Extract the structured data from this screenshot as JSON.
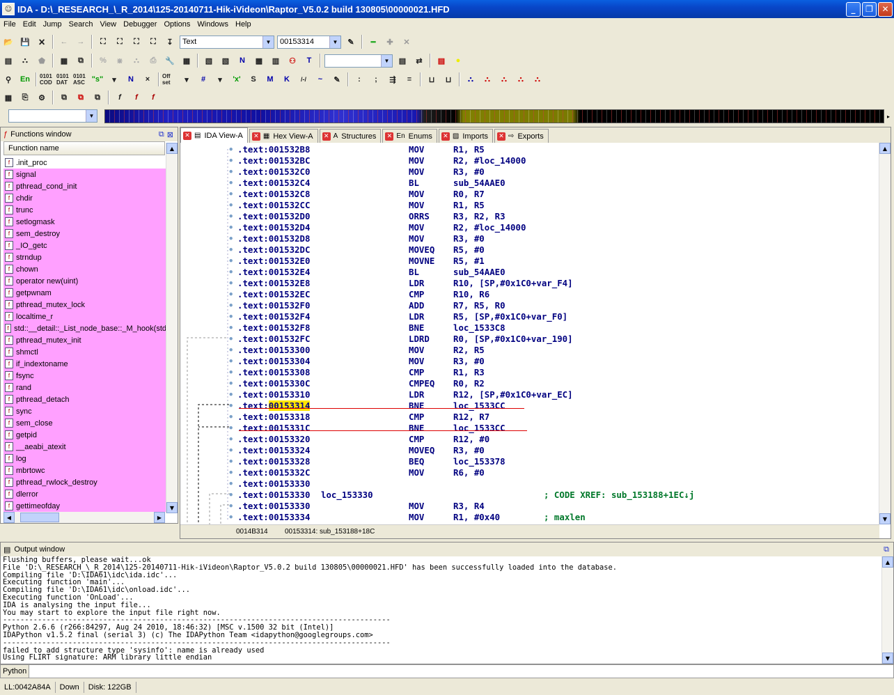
{
  "window": {
    "title": "IDA - D:\\_RESEARCH_\\_R_2014\\125-20140711-Hik-iVideon\\Raptor_V5.0.2 build 130805\\00000021.HFD",
    "minimize": "_",
    "maximize": "❐",
    "close": "✕"
  },
  "menu": [
    "File",
    "Edit",
    "Jump",
    "Search",
    "View",
    "Debugger",
    "Options",
    "Windows",
    "Help"
  ],
  "toolbar": {
    "segment_combo": "Text",
    "address_combo": "00153314",
    "row3": [
      "En",
      "0101 COD",
      "0101 DAT",
      "0101 ASC",
      "\"s\"",
      "N",
      "×",
      "Off set",
      "#",
      "'x'",
      "S",
      "M",
      "K",
      "/-/",
      "~"
    ],
    "row4": [
      "f",
      "f",
      "f"
    ]
  },
  "functions_window": {
    "title": "Functions window",
    "column_header": "Function name",
    "items": [
      ".init_proc",
      "signal",
      "pthread_cond_init",
      "chdir",
      "trunc",
      "setlogmask",
      "sem_destroy",
      "_IO_getc",
      "strndup",
      "chown",
      "operator new(uint)",
      "getpwnam",
      "pthread_mutex_lock",
      "localtime_r",
      "std::__detail::_List_node_base::_M_hook(std",
      "pthread_mutex_init",
      "shmctl",
      "if_indextoname",
      "fsync",
      "rand",
      "pthread_detach",
      "sync",
      "sem_close",
      "getpid",
      "__aeabi_atexit",
      "log",
      "mbrtowc",
      "pthread_rwlock_destroy",
      "dlerror",
      "gettimeofday"
    ]
  },
  "ida_tabs": [
    {
      "label": "IDA View-A",
      "icon": "▤",
      "active": true
    },
    {
      "label": "Hex View-A",
      "icon": "▦",
      "active": false
    },
    {
      "label": "Structures",
      "icon": "A",
      "active": false
    },
    {
      "label": "Enums",
      "icon": "En",
      "active": false
    },
    {
      "label": "Imports",
      "icon": "▨",
      "active": false
    },
    {
      "label": "Exports",
      "icon": "⇨",
      "active": false
    }
  ],
  "disasm": [
    {
      "addr": ".text:001532B8",
      "label": "",
      "op": "MOV",
      "arg": "R1, R5",
      "cmt": ""
    },
    {
      "addr": ".text:001532BC",
      "label": "",
      "op": "MOV",
      "arg": "R2, #loc_14000",
      "cmt": ""
    },
    {
      "addr": ".text:001532C0",
      "label": "",
      "op": "MOV",
      "arg": "R3, #0",
      "cmt": ""
    },
    {
      "addr": ".text:001532C4",
      "label": "",
      "op": "BL",
      "arg": "sub_54AAE0",
      "cmt": ""
    },
    {
      "addr": ".text:001532C8",
      "label": "",
      "op": "MOV",
      "arg": "R0, R7",
      "cmt": ""
    },
    {
      "addr": ".text:001532CC",
      "label": "",
      "op": "MOV",
      "arg": "R1, R5",
      "cmt": ""
    },
    {
      "addr": ".text:001532D0",
      "label": "",
      "op": "ORRS",
      "arg": "R3, R2, R3",
      "cmt": ""
    },
    {
      "addr": ".text:001532D4",
      "label": "",
      "op": "MOV",
      "arg": "R2, #loc_14000",
      "cmt": ""
    },
    {
      "addr": ".text:001532D8",
      "label": "",
      "op": "MOV",
      "arg": "R3, #0",
      "cmt": ""
    },
    {
      "addr": ".text:001532DC",
      "label": "",
      "op": "MOVEQ",
      "arg": "R5, #0",
      "cmt": ""
    },
    {
      "addr": ".text:001532E0",
      "label": "",
      "op": "MOVNE",
      "arg": "R5, #1",
      "cmt": ""
    },
    {
      "addr": ".text:001532E4",
      "label": "",
      "op": "BL",
      "arg": "sub_54AAE0",
      "cmt": ""
    },
    {
      "addr": ".text:001532E8",
      "label": "",
      "op": "LDR",
      "arg": "R10, [SP,#0x1C0+var_F4]",
      "cmt": ""
    },
    {
      "addr": ".text:001532EC",
      "label": "",
      "op": "CMP",
      "arg": "R10, R6",
      "cmt": ""
    },
    {
      "addr": ".text:001532F0",
      "label": "",
      "op": "ADD",
      "arg": "R7, R5, R0",
      "cmt": ""
    },
    {
      "addr": ".text:001532F4",
      "label": "",
      "op": "LDR",
      "arg": "R5, [SP,#0x1C0+var_F0]",
      "cmt": ""
    },
    {
      "addr": ".text:001532F8",
      "label": "",
      "op": "BNE",
      "arg": "loc_1533C8",
      "cmt": ""
    },
    {
      "addr": ".text:001532FC",
      "label": "",
      "op": "LDRD",
      "arg": "R0, [SP,#0x1C0+var_190]",
      "cmt": ""
    },
    {
      "addr": ".text:00153300",
      "label": "",
      "op": "MOV",
      "arg": "R2, R5",
      "cmt": ""
    },
    {
      "addr": ".text:00153304",
      "label": "",
      "op": "MOV",
      "arg": "R3, #0",
      "cmt": ""
    },
    {
      "addr": ".text:00153308",
      "label": "",
      "op": "CMP",
      "arg": "R1, R3",
      "cmt": ""
    },
    {
      "addr": ".text:0015330C",
      "label": "",
      "op": "CMPEQ",
      "arg": "R0, R2",
      "cmt": ""
    },
    {
      "addr": ".text:00153310",
      "label": "",
      "op": "LDR",
      "arg": "R12, [SP,#0x1C0+var_EC]",
      "cmt": ""
    },
    {
      "addr": ".text:00153314",
      "label": "",
      "op": "BNE",
      "arg": "loc_1533CC",
      "cmt": "",
      "highlight": true
    },
    {
      "addr": ".text:00153318",
      "label": "",
      "op": "CMP",
      "arg": "R12, R7",
      "cmt": ""
    },
    {
      "addr": ".text:0015331C",
      "label": "",
      "op": "BNE",
      "arg": "loc_1533CC",
      "cmt": ""
    },
    {
      "addr": ".text:00153320",
      "label": "",
      "op": "CMP",
      "arg": "R12, #0",
      "cmt": ""
    },
    {
      "addr": ".text:00153324",
      "label": "",
      "op": "MOVEQ",
      "arg": "R3, #0",
      "cmt": ""
    },
    {
      "addr": ".text:00153328",
      "label": "",
      "op": "BEQ",
      "arg": "loc_153378",
      "cmt": ""
    },
    {
      "addr": ".text:0015332C",
      "label": "",
      "op": "MOV",
      "arg": "R6, #0",
      "cmt": ""
    },
    {
      "addr": ".text:00153330",
      "label": "",
      "op": "",
      "arg": "",
      "cmt": ""
    },
    {
      "addr": ".text:00153330",
      "label": "loc_153330",
      "op": "",
      "arg": "",
      "cmt": "; CODE XREF: sub_153188+1EC↓j"
    },
    {
      "addr": ".text:00153330",
      "label": "",
      "op": "MOV",
      "arg": "R3, R4",
      "cmt": ""
    },
    {
      "addr": ".text:00153334",
      "label": "",
      "op": "MOV",
      "arg": "R1, #0x40",
      "cmt": "; maxlen"
    }
  ],
  "ida_status": {
    "left": "0014B314",
    "right": "00153314: sub_153188+18C"
  },
  "output_window": {
    "title": "Output window",
    "lines": [
      "Flushing buffers, please wait...ok",
      "File 'D:\\_RESEARCH_\\_R_2014\\125-20140711-Hik-iVideon\\Raptor_V5.0.2 build 130805\\00000021.HFD' has been successfully loaded into the database.",
      "Compiling file 'D:\\IDA61\\idc\\ida.idc'...",
      "Executing function 'main'...",
      "Compiling file 'D:\\IDA61\\idc\\onload.idc'...",
      "Executing function 'OnLoad'...",
      "IDA is analysing the input file...",
      "You may start to explore the input file right now.",
      "-----------------------------------------------------------------------------------------",
      "Python 2.6.6 (r266:84297, Aug 24 2010, 18:46:32) [MSC v.1500 32 bit (Intel)]",
      "IDAPython v1.5.2 final (serial 3) (c) The IDAPython Team <idapython@googlegroups.com>",
      "-----------------------------------------------------------------------------------------",
      "failed to add structure type 'sysinfo': name is already used",
      "Using FLIRT signature: ARM library little endian"
    ]
  },
  "python_label": "Python",
  "statusbar": [
    "LL:0042A84A",
    "Down",
    "Disk: 122GB"
  ]
}
